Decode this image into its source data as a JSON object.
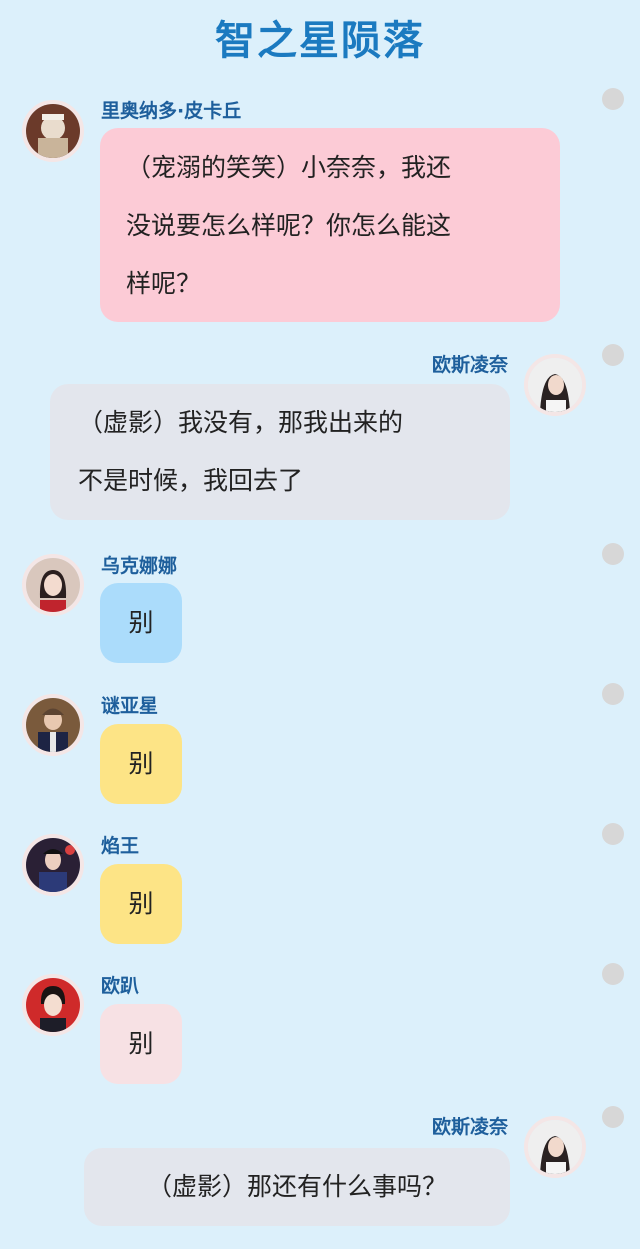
{
  "header": {
    "title": "智之星陨落"
  },
  "messages": [
    {
      "speaker": "里奥纳多·皮卡丘",
      "text": "（宠溺的笑笑）小奈奈，我还没说要怎么样呢？你怎么能这样呢？",
      "lines": [
        "（宠溺的笑笑）小奈奈，我还",
        "没说要怎么样呢？你怎么能这",
        "样呢？"
      ],
      "side": "left",
      "bubble_color": "#fccbd6"
    },
    {
      "speaker": "欧斯凌奈",
      "text": "（虚影）我没有，那我出来的不是时候，我回去了",
      "lines": [
        "（虚影）我没有，那我出来的",
        "不是时候，我回去了"
      ],
      "side": "right",
      "bubble_color": "#e3e6ed"
    },
    {
      "speaker": "乌克娜娜",
      "text": "别",
      "side": "left",
      "bubble_color": "#abdcfb"
    },
    {
      "speaker": "谜亚星",
      "text": "别",
      "side": "left",
      "bubble_color": "#fde486"
    },
    {
      "speaker": "焰王",
      "text": "别",
      "side": "left",
      "bubble_color": "#fde486"
    },
    {
      "speaker": "欧趴",
      "text": "别",
      "side": "left",
      "bubble_color": "#f7e1e4"
    },
    {
      "speaker": "欧斯凌奈",
      "text": "（虚影）那还有什么事吗？",
      "side": "right",
      "bubble_color": "#e3e6ed"
    }
  ],
  "colors": {
    "background": "#dcf0fb",
    "title": "#1b7ac0",
    "name": "#1e5f9c",
    "dot": "#d7d7d7"
  },
  "icons": [
    "avatar-icon",
    "status-dot-icon"
  ]
}
